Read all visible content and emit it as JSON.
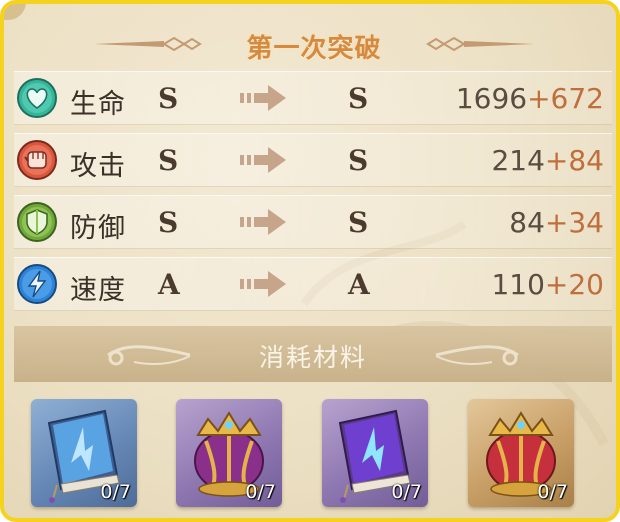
{
  "title": "第一次突破",
  "stats": [
    {
      "icon": "heart-icon",
      "label": "生命",
      "from_grade": "S",
      "to_grade": "S",
      "base": "1696",
      "bonus": "+672",
      "color": "#35b59a"
    },
    {
      "icon": "fist-icon",
      "label": "攻击",
      "from_grade": "S",
      "to_grade": "S",
      "base": "214",
      "bonus": "+84",
      "color": "#d9573d"
    },
    {
      "icon": "shield-icon",
      "label": "防御",
      "from_grade": "S",
      "to_grade": "S",
      "base": "84",
      "bonus": "+34",
      "color": "#72a83b"
    },
    {
      "icon": "lightning-icon",
      "label": "速度",
      "from_grade": "A",
      "to_grade": "A",
      "base": "110",
      "bonus": "+20",
      "color": "#2f83d6"
    }
  ],
  "materials": {
    "header": "消耗材料",
    "items": [
      {
        "icon": "blue-book-icon",
        "count": "0/7",
        "rarity": "blue"
      },
      {
        "icon": "purple-crown-icon",
        "count": "0/7",
        "rarity": "purple"
      },
      {
        "icon": "purple-book-icon",
        "count": "0/7",
        "rarity": "purple"
      },
      {
        "icon": "gold-crown-icon",
        "count": "0/7",
        "rarity": "gold"
      }
    ]
  },
  "colors": {
    "frame": "#f5d21e",
    "title": "#d58a3f",
    "bonus": "#bf6f3c",
    "panel": "#ece0c4"
  }
}
